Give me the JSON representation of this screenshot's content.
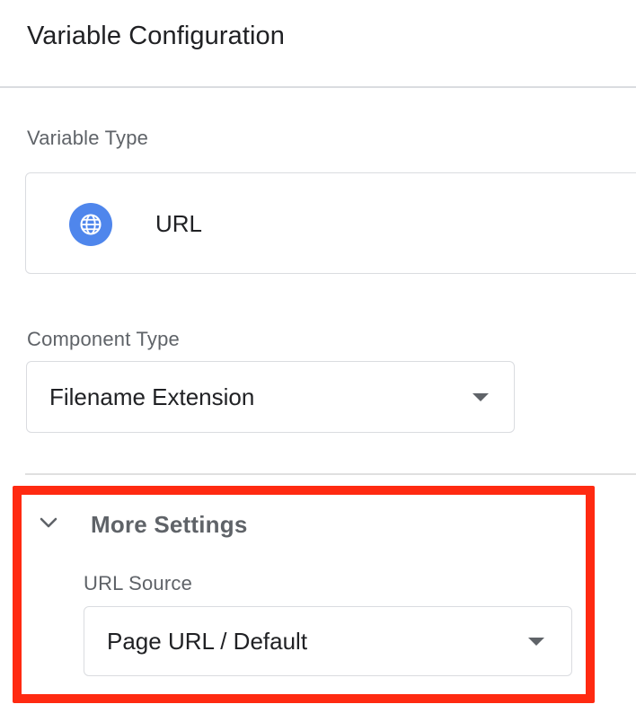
{
  "panel": {
    "title": "Variable Configuration"
  },
  "variable_type": {
    "label": "Variable Type",
    "selected": "URL",
    "icon": "globe-icon",
    "icon_color": "#4f86ec"
  },
  "component_type": {
    "label": "Component Type",
    "selected": "Filename Extension"
  },
  "more_settings": {
    "label": "More Settings",
    "expanded": true,
    "highlight_color": "#ff2a11",
    "url_source": {
      "label": "URL Source",
      "selected": "Page URL / Default"
    }
  }
}
